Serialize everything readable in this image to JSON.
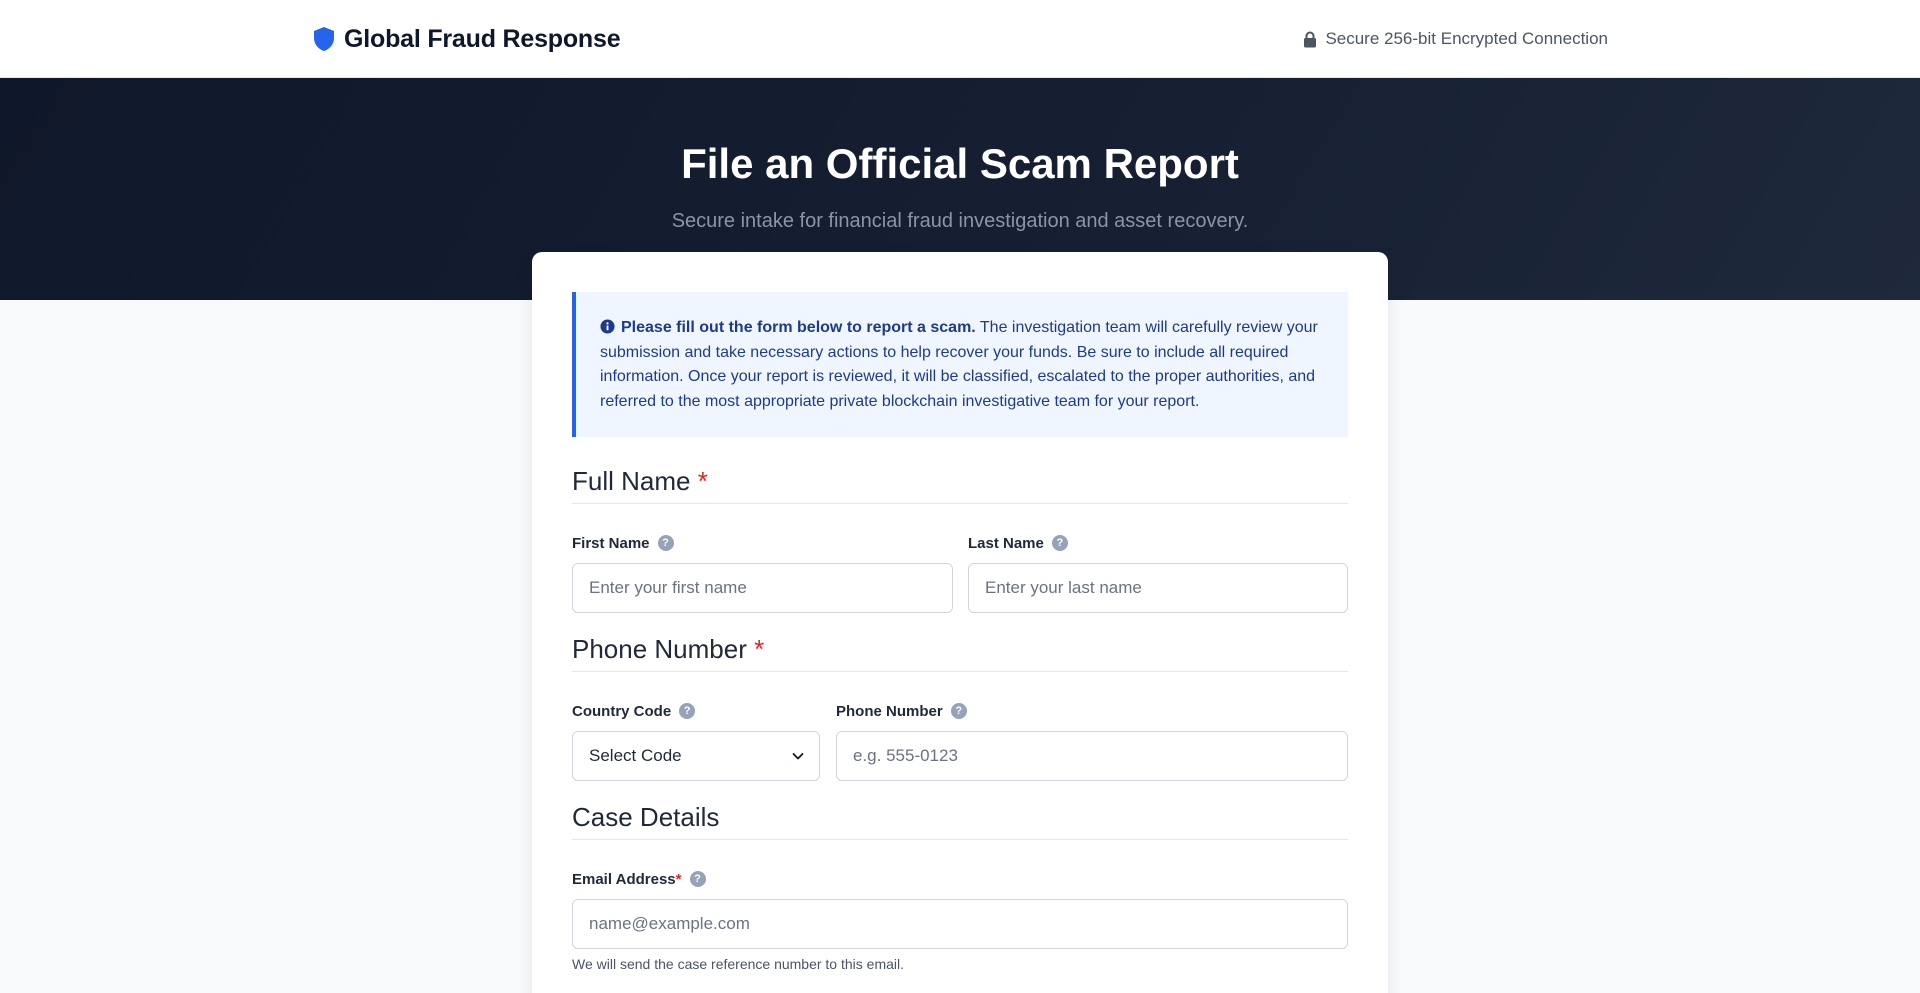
{
  "header": {
    "brand": "Global Fraud Response",
    "secure_text": "Secure 256-bit Encrypted Connection"
  },
  "hero": {
    "title": "File an Official Scam Report",
    "subtitle": "Secure intake for financial fraud investigation and asset recovery."
  },
  "notice": {
    "lead": "Please fill out the form below to report a scam.",
    "body": " The investigation team will carefully review your submission and take necessary actions to help recover your funds. Be sure to include all required information. Once your report is reviewed, it will be classified, escalated to the proper authorities, and referred to the most appropriate private blockchain investigative team for your report."
  },
  "sections": {
    "full_name": {
      "title": "Full Name",
      "required_mark": "*"
    },
    "phone": {
      "title": "Phone Number",
      "required_mark": "*"
    },
    "case": {
      "title": "Case Details"
    }
  },
  "fields": {
    "first_name": {
      "label": "First Name",
      "value": "",
      "placeholder": "Enter your first name"
    },
    "last_name": {
      "label": "Last Name",
      "value": "",
      "placeholder": "Enter your last name"
    },
    "country_code": {
      "label": "Country Code",
      "selected": "Select Code"
    },
    "phone_number": {
      "label": "Phone Number",
      "value": "",
      "placeholder": "e.g. 555-0123"
    },
    "email": {
      "label": "Email Address",
      "required_mark": "*",
      "value": "",
      "placeholder": "name@example.com",
      "hint": "We will send the case reference number to this email."
    }
  },
  "help_glyph": "?",
  "icons": {
    "brand": "shield-icon",
    "secure": "lock-icon",
    "notice": "info-icon",
    "help": "question-icon",
    "select": "chevron-down-icon"
  },
  "colors": {
    "brand_blue": "#2563eb",
    "hero_bg": "#0f172a",
    "required_red": "#dc2626",
    "notice_bg": "#eff6ff",
    "notice_text": "#1e3a8a"
  }
}
